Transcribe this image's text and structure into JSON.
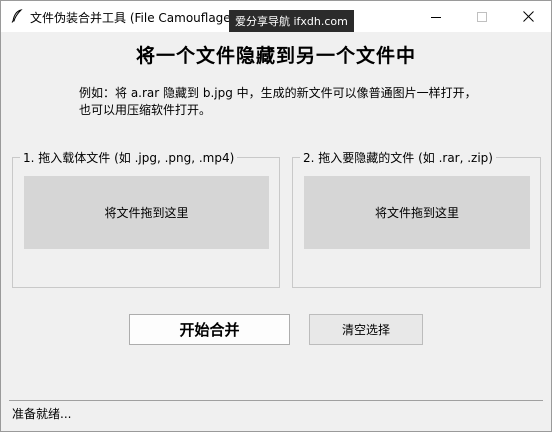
{
  "titlebar": {
    "title": "文件伪装合并工具 (File Camouflage",
    "watermark": "爱分享导航 ifxdh.com",
    "icon": "feather-icon"
  },
  "main": {
    "heading": "将一个文件隐藏到另一个文件中",
    "desc_line1": "例如：将 a.rar 隐藏到 b.jpg 中，生成的新文件可以像普通图片一样打开，",
    "desc_line2": "也可以用压缩软件打开。"
  },
  "groups": [
    {
      "legend": "1. 拖入载体文件 (如 .jpg, .png, .mp4)",
      "drop_text": "将文件拖到这里"
    },
    {
      "legend": "2. 拖入要隐藏的文件 (如 .rar, .zip)",
      "drop_text": "将文件拖到这里"
    }
  ],
  "buttons": {
    "merge": "开始合并",
    "clear": "清空选择"
  },
  "status": {
    "text": "准备就绪..."
  },
  "colors": {
    "window_bg": "#f0f0f0",
    "dropzone_bg": "#d6d6d6",
    "watermark_bg": "#2b2b2b"
  }
}
